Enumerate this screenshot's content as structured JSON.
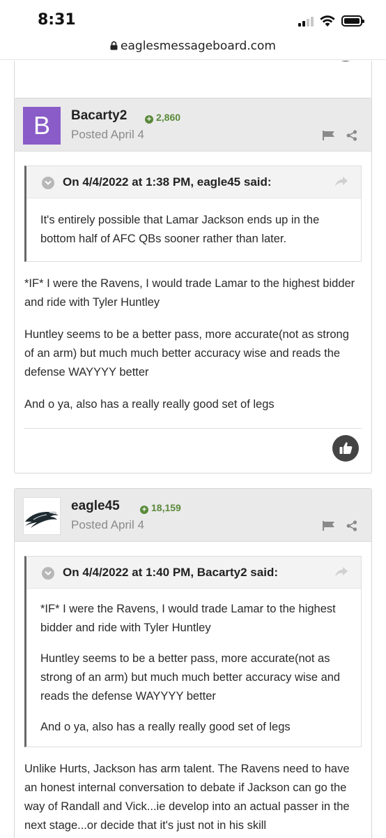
{
  "status_bar": {
    "time": "8:31"
  },
  "browser": {
    "url": "eaglesmessageboard.com"
  },
  "posts": [
    {
      "author": "Bacarty2",
      "avatar_letter": "B",
      "avatar_color": "#8a5cc8",
      "reputation": "2,860",
      "posted": "Posted April 4",
      "quote": {
        "cite": "On 4/4/2022 at 1:38 PM, eagle45 said:",
        "paragraphs": [
          "It's entirely possible that Lamar Jackson ends up in the bottom half of AFC QBs sooner rather than later."
        ]
      },
      "paragraphs": [
        "*IF* I were the Ravens, I would trade Lamar to the highest bidder and ride with Tyler Huntley",
        "Huntley seems to be a better pass, more accurate(not as strong of an arm) but much much better accuracy wise and reads the defense WAYYYY better",
        "And o ya, also has a really really good set of legs"
      ]
    },
    {
      "author": "eagle45",
      "avatar_icon": "eagle-logo-icon",
      "reputation": "18,159",
      "posted": "Posted April 4",
      "quote": {
        "cite": "On 4/4/2022 at 1:40 PM, Bacarty2 said:",
        "paragraphs": [
          "*IF* I were the Ravens, I would trade Lamar to the highest bidder and ride with Tyler Huntley",
          "Huntley seems to be a better pass, more accurate(not as strong of an arm) but much much better accuracy wise and reads the defense WAYYYY better",
          "And o ya, also has a really really good set of legs"
        ]
      },
      "paragraphs": [
        "Unlike Hurts, Jackson has arm talent.  The Ravens need to have an honest internal conversation to debate if Jackson can go the way of Randall and Vick...ie develop into an actual passer in the next stage...or decide that it's just not in his skill"
      ]
    }
  ],
  "colors": {
    "reputation": "#5a8a3a",
    "header_bg": "#eaeaea",
    "like_button": "#444444"
  }
}
